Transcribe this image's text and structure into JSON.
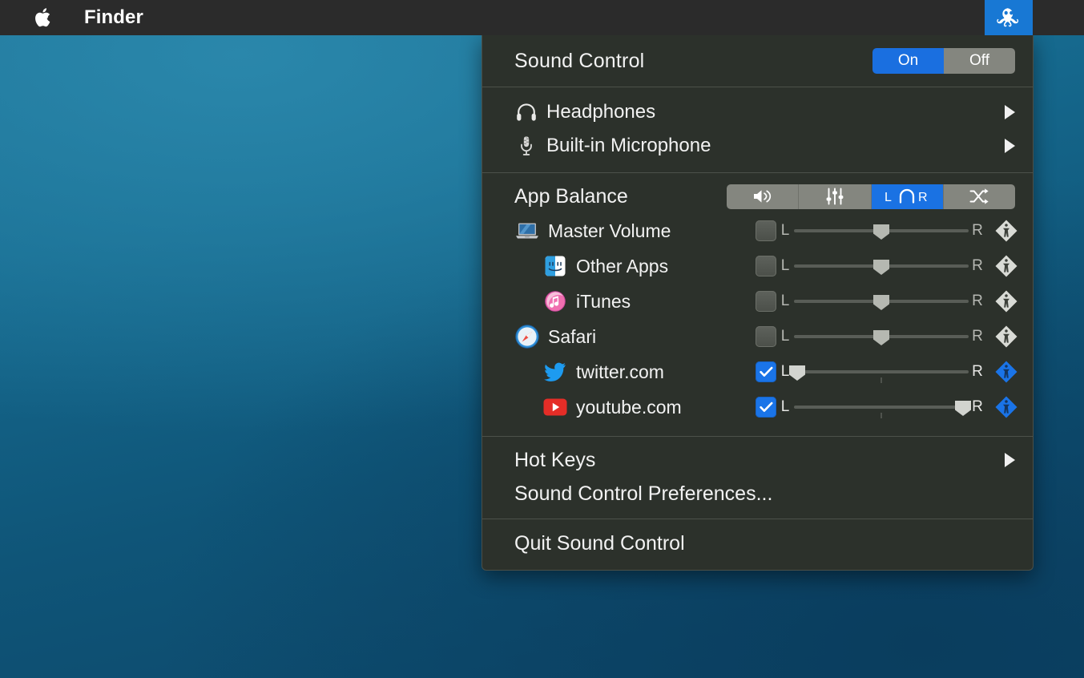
{
  "menubar": {
    "apple_icon": "apple-logo-icon",
    "app_name": "Finder",
    "status_icon": "octopus-icon"
  },
  "colors": {
    "accent_blue": "#1a72e3",
    "toggle_on": "#1a6fe0",
    "toggle_off": "#84867f",
    "menu_bg": "#2c312b",
    "menubar_bg": "#2b2b2b",
    "text": "#f2f2f2",
    "desktop_top": "#1c7296",
    "desktop_bottom": "#0c4568"
  },
  "menu": {
    "header": {
      "title": "Sound Control",
      "toggle": {
        "on_label": "On",
        "off_label": "Off",
        "selected": "On"
      }
    },
    "devices": [
      {
        "label": "Headphones",
        "icon": "headphones-icon",
        "submenu_arrow": "triangle-right-icon"
      },
      {
        "label": "Built-in Microphone",
        "icon": "microphone-icon",
        "submenu_arrow": "triangle-right-icon"
      }
    ],
    "balance": {
      "title": "App Balance",
      "modes": [
        {
          "name": "volume",
          "icon": "speaker-volume-icon",
          "selected": false
        },
        {
          "name": "equalizer",
          "icon": "equalizer-sliders-icon",
          "selected": false
        },
        {
          "name": "balance",
          "icon": "balance-lr-icon",
          "label_left": "L",
          "label_right": "R",
          "selected": true
        },
        {
          "name": "routing",
          "icon": "shuffle-routing-icon",
          "selected": false
        }
      ],
      "label_left": "L",
      "label_right": "R",
      "rows": [
        {
          "name": "Master Volume",
          "icon": "macbook-icon",
          "indent": 0,
          "checked": false,
          "balance": 50,
          "active": false
        },
        {
          "name": "Other Apps",
          "icon": "finder-icon",
          "indent": 1,
          "checked": false,
          "balance": 50,
          "active": false
        },
        {
          "name": "iTunes",
          "icon": "itunes-icon",
          "indent": 1,
          "checked": false,
          "balance": 50,
          "active": false
        },
        {
          "name": "Safari",
          "icon": "safari-icon",
          "indent": 0,
          "checked": false,
          "balance": 50,
          "active": false
        },
        {
          "name": "twitter.com",
          "icon": "twitter-icon",
          "indent": 1,
          "checked": true,
          "balance": 0,
          "active": true
        },
        {
          "name": "youtube.com",
          "icon": "youtube-icon",
          "indent": 1,
          "checked": true,
          "balance": 100,
          "active": true
        }
      ]
    },
    "items": [
      {
        "label": "Hot Keys",
        "submenu_arrow": "triangle-right-icon"
      },
      {
        "label": "Sound Control Preferences...",
        "submenu_arrow": null
      }
    ],
    "quit": {
      "label": "Quit Sound Control"
    }
  }
}
